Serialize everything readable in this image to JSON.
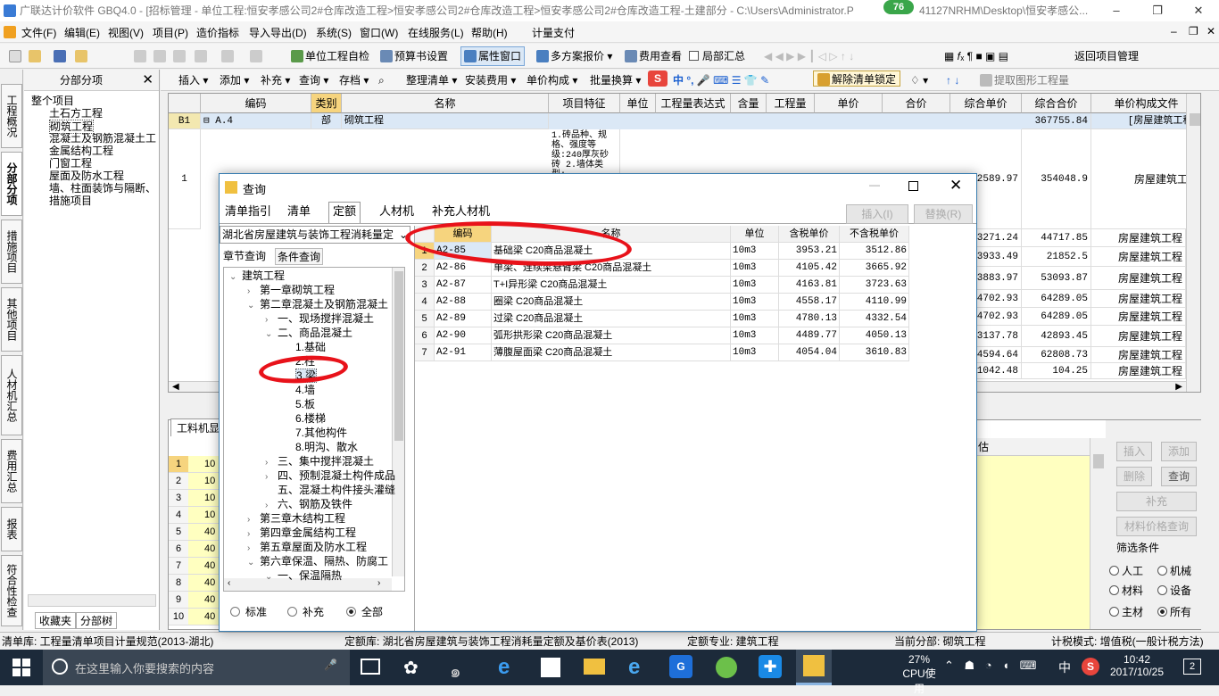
{
  "window": {
    "title": "广联达计价软件 GBQ4.0 - [招标管理 - 单位工程:恒安孝感公司2#仓库改造工程>恒安孝感公司2#仓库改造工程>恒安孝感公司2#仓库改造工程-土建部分 - C:\\Users\\Administrator.P",
    "title_tail": "41127NRHM\\Desktop\\恒安孝感公...",
    "badge": "76",
    "minimize": "–",
    "restore": "❐",
    "close": "✕"
  },
  "menu": [
    "文件(F)",
    "编辑(E)",
    "视图(V)",
    "项目(P)",
    "造价指标",
    "导入导出(D)",
    "系统(S)",
    "窗口(W)",
    "在线服务(L)",
    "帮助(H)",
    "计量支付"
  ],
  "toolbar1": {
    "self_check": "单位工程自检",
    "budget_settings": "预算书设置",
    "property_window": "属性窗口",
    "multi_quote": "多方案报价",
    "fee_view": "费用查看",
    "local_summary": "局部汇总",
    "back_to_project": "返回项目管理"
  },
  "toolbar2": [
    "插入",
    "添加",
    "补充",
    "查询",
    "存档",
    "整理清单",
    "安装费用",
    "单价构成",
    "批量换算",
    "解除清单锁定",
    "提取图形工程量"
  ],
  "side_tabs": [
    "工程概况",
    "分部分项",
    "措施项目",
    "其他项目",
    "人材机汇总",
    "费用汇总",
    "报表",
    "符合性检查"
  ],
  "left_panel": {
    "title": "分部分项",
    "close": "✕",
    "items": [
      "整个项目",
      "土石方工程",
      "砌筑工程",
      "混凝土及钢筋混凝土工",
      "金属结构工程",
      "门窗工程",
      "屋面及防水工程",
      "墙、柱面装饰与隔断、",
      "措施项目"
    ],
    "bottom_tabs": [
      "收藏夹",
      "分部树"
    ]
  },
  "grid": {
    "headers": [
      "编码",
      "类别",
      "名称",
      "项目特征",
      "单位",
      "工程量表达式",
      "含量",
      "工程量",
      "单价",
      "合价",
      "综合单价",
      "综合合价",
      "单价构成文件"
    ],
    "row_b1": {
      "no": "B1",
      "code": "A.4",
      "type": "部",
      "name": "砌筑工程",
      "total": "367755.84",
      "file": "[房屋建筑工程]"
    },
    "row1": {
      "no": "1",
      "feature": "1.砖品种、规格、强度等级:240厚灰砂砖 2.墙体类型:",
      "unit_price": "2589.97",
      "total": "354048.9",
      "file": "房屋建筑工程"
    },
    "right_rows": [
      {
        "price": "3271.24",
        "total": "44717.85",
        "file": "房屋建筑工程"
      },
      {
        "price": "3933.49",
        "total": "21852.5",
        "file": "房屋建筑工程"
      },
      {
        "price": "3883.97",
        "total": "53093.87",
        "file": "房屋建筑工程"
      },
      {
        "price": "4702.93",
        "total": "64289.05",
        "file": "房屋建筑工程"
      },
      {
        "price": "4702.93",
        "total": "64289.05",
        "file": "房屋建筑工程"
      },
      {
        "price": "3137.78",
        "total": "42893.45",
        "file": "房屋建筑工程"
      },
      {
        "price": "4594.64",
        "total": "62808.73",
        "file": "房屋建筑工程"
      },
      {
        "price": "1042.48",
        "total": "104.25",
        "file": "房屋建筑工程"
      }
    ]
  },
  "lower": {
    "tab": "工料机显",
    "row_numbers": [
      "1",
      "2",
      "3",
      "4",
      "5",
      "6",
      "7",
      "8",
      "9",
      "10"
    ],
    "row_codes": [
      "10",
      "10",
      "10",
      "10",
      "40",
      "40",
      "40",
      "40",
      "40",
      "40"
    ],
    "header_right": "估"
  },
  "right_buttons": {
    "insert": "插入",
    "add": "添加",
    "delete": "删除",
    "query": "查询",
    "supplement": "补充",
    "price_query": "材料价格查询",
    "filter_title": "筛选条件",
    "filters": [
      "人工",
      "机械",
      "材料",
      "设备",
      "主材",
      "所有"
    ],
    "filter_selected": "所有"
  },
  "dialog": {
    "title": "查询",
    "tabs": [
      "清单指引",
      "清单",
      "定额",
      "人材机",
      "补充人材机"
    ],
    "active_tab": "定额",
    "insert_btn": "插入(I)",
    "replace_btn": "替换(R)",
    "norm_select": "湖北省房屋建筑与装饰工程消耗量定",
    "sub_tabs": [
      "章节查询",
      "条件查询"
    ],
    "tree": [
      {
        "t": "建筑工程",
        "lvl": 0,
        "exp": "v"
      },
      {
        "t": "第一章砌筑工程",
        "lvl": 1,
        "exp": ">"
      },
      {
        "t": "第二章混凝土及钢筋混凝土",
        "lvl": 1,
        "exp": "v"
      },
      {
        "t": "一、现场搅拌混凝土",
        "lvl": 2,
        "exp": ">"
      },
      {
        "t": "二、商品混凝土",
        "lvl": 2,
        "exp": "v"
      },
      {
        "t": "1.基础",
        "lvl": 3,
        "exp": ""
      },
      {
        "t": "2.柱",
        "lvl": 3,
        "exp": ""
      },
      {
        "t": "3.梁",
        "lvl": 3,
        "exp": ""
      },
      {
        "t": "4.墙",
        "lvl": 3,
        "exp": ""
      },
      {
        "t": "5.板",
        "lvl": 3,
        "exp": ""
      },
      {
        "t": "6.楼梯",
        "lvl": 3,
        "exp": ""
      },
      {
        "t": "7.其他构件",
        "lvl": 3,
        "exp": ""
      },
      {
        "t": "8.明沟、散水",
        "lvl": 3,
        "exp": ""
      },
      {
        "t": "三、集中搅拌混凝土",
        "lvl": 2,
        "exp": ">"
      },
      {
        "t": "四、预制混凝土构件成品",
        "lvl": 2,
        "exp": ">"
      },
      {
        "t": "五、混凝土构件接头灌缝",
        "lvl": 2,
        "exp": ""
      },
      {
        "t": "六、钢筋及铁件",
        "lvl": 2,
        "exp": ">"
      },
      {
        "t": "第三章木结构工程",
        "lvl": 1,
        "exp": ">"
      },
      {
        "t": "第四章金属结构工程",
        "lvl": 1,
        "exp": ">"
      },
      {
        "t": "第五章屋面及防水工程",
        "lvl": 1,
        "exp": ">"
      },
      {
        "t": "第六章保温、隔热、防腐工",
        "lvl": 1,
        "exp": "v"
      },
      {
        "t": "一、保温隔热",
        "lvl": 2,
        "exp": "v"
      }
    ],
    "radio": [
      "标准",
      "补充",
      "全部"
    ],
    "radio_selected": "全部",
    "table_headers": [
      "编码",
      "名称",
      "单位",
      "含税单价",
      "不含税单价"
    ],
    "rows": [
      {
        "no": "1",
        "code": "A2-85",
        "name": "基础梁 C20商品混凝土",
        "unit": "10m3",
        "tax": "3953.21",
        "notax": "3512.86"
      },
      {
        "no": "2",
        "code": "A2-86",
        "name": "单梁、连续梁悬臂梁 C20商品混凝土",
        "unit": "10m3",
        "tax": "4105.42",
        "notax": "3665.92"
      },
      {
        "no": "3",
        "code": "A2-87",
        "name": "T+I异形梁 C20商品混凝土",
        "unit": "10m3",
        "tax": "4163.81",
        "notax": "3723.63"
      },
      {
        "no": "4",
        "code": "A2-88",
        "name": "圈梁 C20商品混凝土",
        "unit": "10m3",
        "tax": "4558.17",
        "notax": "4110.99"
      },
      {
        "no": "5",
        "code": "A2-89",
        "name": "过梁 C20商品混凝土",
        "unit": "10m3",
        "tax": "4780.13",
        "notax": "4332.54"
      },
      {
        "no": "6",
        "code": "A2-90",
        "name": "弧形拱形梁 C20商品混凝土",
        "unit": "10m3",
        "tax": "4489.77",
        "notax": "4050.13"
      },
      {
        "no": "7",
        "code": "A2-91",
        "name": "薄腹屋面梁 C20商品混凝土",
        "unit": "10m3",
        "tax": "4054.04",
        "notax": "3610.83"
      }
    ]
  },
  "status": {
    "list_lib": "清单库: 工程量清单项目计量规范(2013-湖北)",
    "norm_lib": "定额库: 湖北省房屋建筑与装饰工程消耗量定额及基价表(2013)",
    "norm_major": "定额专业: 建筑工程",
    "current": "当前分部: 砌筑工程",
    "tax_mode": "计税模式: 增值税(一般计税方法)"
  },
  "taskbar": {
    "search_placeholder": "在这里输入你要搜索的内容",
    "cpu_pct": "27%",
    "cpu_label": "CPU使用",
    "ime": "中",
    "time": "10:42",
    "date": "2017/10/25",
    "notif": "2"
  },
  "colors": {
    "accent": "#0078d7",
    "selection": "#dbe8f6",
    "yellow": "#ffffc0",
    "annotation_red": "#e8121a"
  }
}
